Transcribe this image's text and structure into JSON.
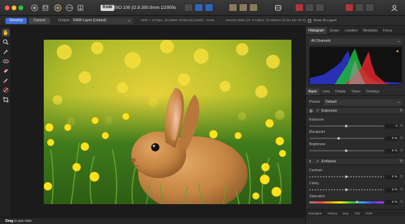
{
  "toolbar": {
    "raw_badge": "RAW",
    "exif": "ISO 100 |/2.8 200.0mm 1/2000s",
    "colors": {
      "accent": "#3d6fd8",
      "close": "#ff5f57",
      "minimize": "#febc2e",
      "zoom": "#28c840"
    }
  },
  "context": {
    "develop_label": "Develop",
    "cancel_label": "Cancel",
    "output_label": "Output:",
    "output_value": "RAW Layer (Linked)",
    "image_info": "5690 × 3728px, 20.66MP, RGBA/32 (HDR) – RAW",
    "camera_info": "NIKON D500 (AF-S Nikkor 70-200mm f/2.8G ED VR II)",
    "show_layers": "Show All Layers"
  },
  "tools": [
    "hand-icon",
    "zoom-icon",
    "eyedropper-icon",
    "red-eye-icon",
    "blemish-icon",
    "brush-icon",
    "overlay-icon",
    "crop-icon"
  ],
  "panel": {
    "top_tabs": [
      "Histogram",
      "Scope",
      "Location",
      "Metadata",
      "Focus"
    ],
    "channels": "All Channels",
    "section_tabs": [
      "Basic",
      "Lens",
      "Details",
      "Tones",
      "Overlays"
    ],
    "preset_label": "Preset:",
    "preset_value": "Default",
    "exposure": {
      "title": "Exposure",
      "sliders": [
        {
          "label": "Exposure",
          "value": "0",
          "level": 0.5
        },
        {
          "label": "Blackpoint",
          "value": "0 %",
          "level": 0.4
        },
        {
          "label": "Brightness",
          "value": "0 %",
          "level": 0.5
        }
      ]
    },
    "enhance": {
      "title": "Enhance",
      "sliders": [
        {
          "label": "Contrast",
          "value": "0 %",
          "level": 0.5
        },
        {
          "label": "Clarity",
          "value": "0 %",
          "level": 0.5
        },
        {
          "label": "Saturation",
          "value": "0 %",
          "level": 0.64
        }
      ]
    },
    "bottom_tabs": [
      "Navigator",
      "History",
      "Snp.",
      "32b",
      "OCR"
    ]
  },
  "status": {
    "bold": "Drag",
    "text": " to pan view"
  }
}
